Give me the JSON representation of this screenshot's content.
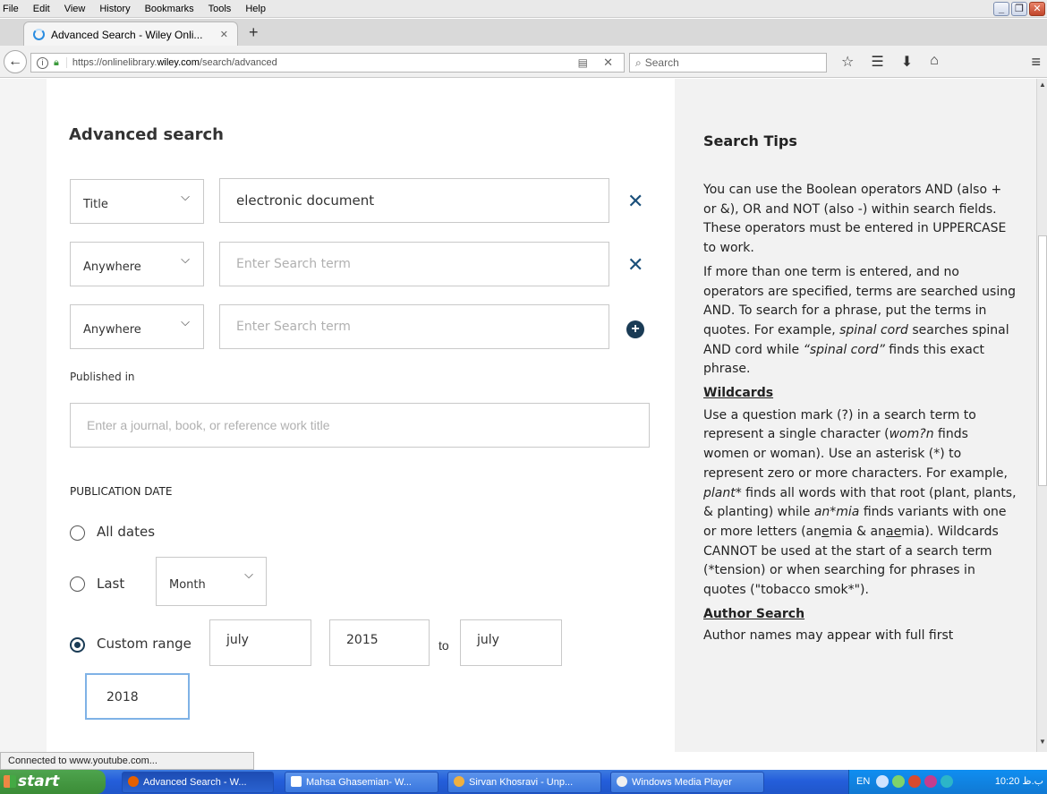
{
  "menu": [
    "File",
    "Edit",
    "View",
    "History",
    "Bookmarks",
    "Tools",
    "Help"
  ],
  "tab": {
    "title": "Advanced Search - Wiley Onli...",
    "close": "✕",
    "new": "+"
  },
  "url": {
    "prefix": "https://onlinelibrary.",
    "domain": "wiley.com",
    "path": "/search/advanced"
  },
  "search_placeholder": "Search",
  "page": {
    "heading": "Advanced search",
    "rows": [
      {
        "field": "Title",
        "value": "electronic document",
        "placeholder": ""
      },
      {
        "field": "Anywhere",
        "value": "",
        "placeholder": "Enter Search term"
      },
      {
        "field": "Anywhere",
        "value": "",
        "placeholder": "Enter Search term"
      }
    ],
    "published_in_label": "Published in",
    "journal_placeholder": "Enter a journal, book, or reference work title",
    "pub_date_label": "PUBLICATION DATE",
    "all_dates": "All dates",
    "last": "Last",
    "last_unit": "Month",
    "custom_range": "Custom range",
    "from_month": "july",
    "from_year": "2015",
    "to_label": "to",
    "to_month": "july",
    "to_year": "2018"
  },
  "tips": {
    "heading": "Search Tips",
    "p1": "You can use the Boolean operators AND (also + or &), OR and NOT (also -) within search fields. These operators must be entered in UPPERCASE to work.",
    "p2a": "If more than one term is entered, and no operators are specified, terms are searched using AND.  To search for a phrase, put the terms in quotes.  For example, ",
    "p2i1": "spinal cord",
    "p2b": " searches spinal AND cord while ",
    "p2i2": "“spinal cord”",
    "p2c": " finds this exact phrase.",
    "h_wild": "Wildcards",
    "p3a": "Use a question mark (?) in a search term to represent a single character (",
    "p3i1": "wom?n",
    "p3b": " finds women or woman).  Use an asterisk (*) to represent zero or more characters.   For example, ",
    "p3i2": "plant*",
    "p3c": " finds all words with that root (plant, plants, & planting) while ",
    "p3i3": "an*mia",
    "p3d": " finds variants with one or more letters (an",
    "p3u1": "e",
    "p3e": "mia & an",
    "p3u2": "ae",
    "p3f": "mia).  Wildcards CANNOT be used at the start of a search term (*tension) or when searching for phrases in quotes (\"tobacco smok*\").",
    "h_author": "Author Search",
    "p4": "Author names may appear with full first"
  },
  "status": "Connected to www.youtube.com...",
  "taskbar": {
    "start": "start",
    "items": [
      "Advanced Search - W...",
      "Mahsa Ghasemian- W...",
      "Sirvan Khosravi - Unp...",
      "Windows Media Player"
    ],
    "lang": "EN",
    "clock": "10:20 ب.ظ"
  }
}
